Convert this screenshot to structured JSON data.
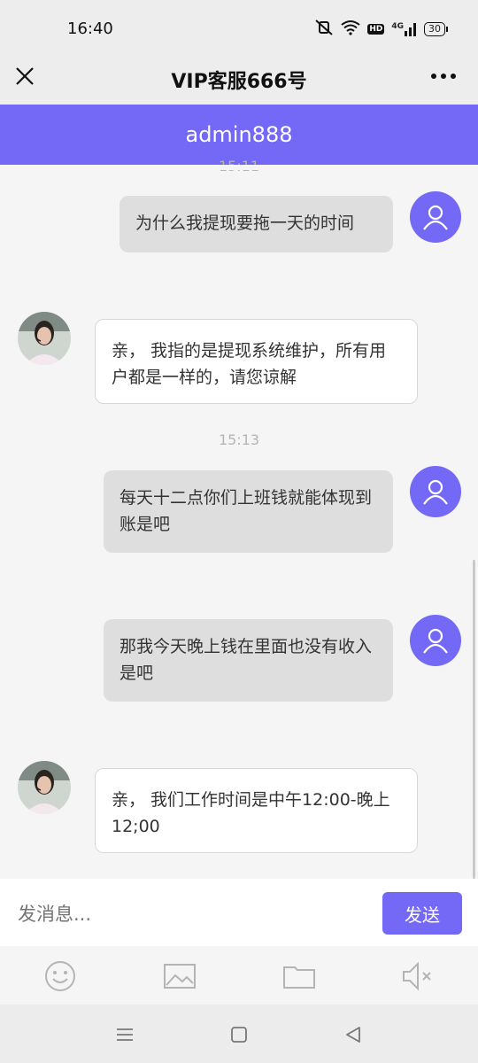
{
  "status_bar": {
    "time": "16:40",
    "hd_label": "HD",
    "network_label": "4G",
    "battery": "30"
  },
  "nav": {
    "title": "VIP客服666号"
  },
  "chat": {
    "peer_name": "admin888",
    "partial_timestamp": "15:11",
    "messages": [
      {
        "side": "right",
        "text": "为什么我提现要拖一天的时间"
      },
      {
        "side": "left",
        "text": "亲， 我指的是提现系统维护，所有用户都是一样的，请您谅解"
      },
      {
        "timestamp": "15:13"
      },
      {
        "side": "right",
        "text": "每天十二点你们上班钱就能体现到账是吧"
      },
      {
        "side": "right",
        "text": "那我今天晚上钱在里面也没有收入是吧"
      },
      {
        "side": "left",
        "text": "亲， 我们工作时间是中午12:00-晚上12;00"
      }
    ]
  },
  "composer": {
    "placeholder": "发消息...",
    "send_label": "发送"
  },
  "toolbar_icons": [
    "emoji-icon",
    "image-icon",
    "folder-icon",
    "mute-icon"
  ],
  "colors": {
    "accent": "#7468f6",
    "bubble_self": "#dedede",
    "bubble_agent": "#ffffff"
  }
}
